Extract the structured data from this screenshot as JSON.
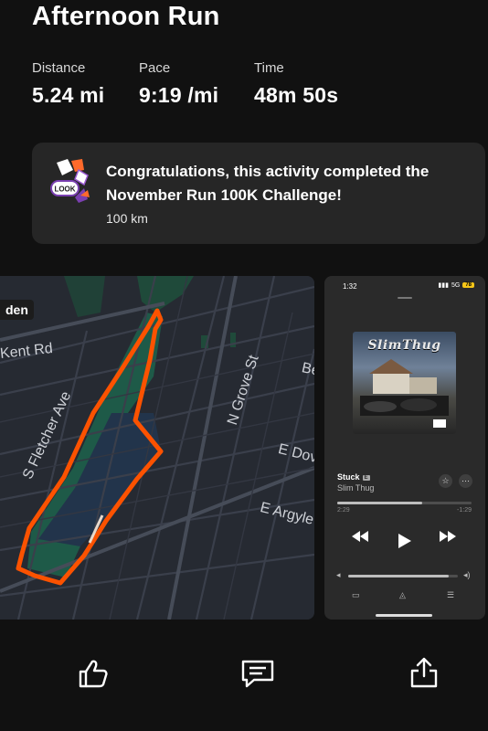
{
  "activity": {
    "title": "Afternoon Run"
  },
  "stats": [
    {
      "label": "Distance",
      "value": "5.24 mi"
    },
    {
      "label": "Pace",
      "value": "9:19 /mi"
    },
    {
      "label": "Time",
      "value": "48m 50s"
    }
  ],
  "challenge": {
    "message": "Congratulations, this activity completed the November Run 100K Challenge!",
    "goal": "100 km",
    "badge_icon": "challenge-badge-icon",
    "badge_text": "LOOK"
  },
  "map": {
    "tag": "den",
    "streets": [
      "Kent Rd",
      "S Fletcher Ave",
      "N Grove St",
      "E Dov",
      "E Argyle",
      "Be"
    ],
    "route_color": "#fc5200"
  },
  "media": {
    "clock": "1:32",
    "network": "5G",
    "battery": "78",
    "album_text": "SlimThug",
    "song": "Stuck",
    "explicit": "E",
    "artist": "Slim Thug",
    "elapsed": "2:29",
    "remaining": "-1:29",
    "progress": 0.63,
    "volume": 0.92,
    "prev_icon": "rewind-icon",
    "play_icon": "play-icon",
    "next_icon": "fast-forward-icon"
  },
  "actions": [
    {
      "name": "kudos",
      "icon": "thumbs-up-icon"
    },
    {
      "name": "comment",
      "icon": "comment-icon"
    },
    {
      "name": "share",
      "icon": "share-icon"
    }
  ]
}
